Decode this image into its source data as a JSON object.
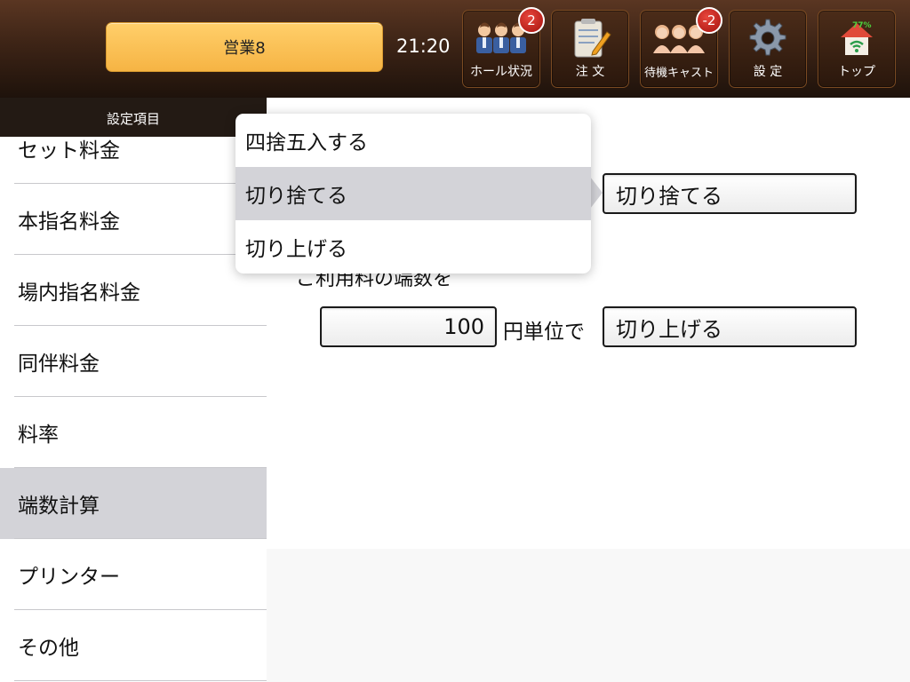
{
  "header": {
    "session_label": "営業8",
    "clock": "21:20",
    "nav": [
      {
        "label": "ホール状況",
        "icon": "staff-group-icon",
        "badge": "2"
      },
      {
        "label": "注 文",
        "icon": "order-notepad-icon",
        "badge": null
      },
      {
        "label": "待機キャスト",
        "icon": "cast-group-icon",
        "badge": "-2"
      },
      {
        "label": "設 定",
        "icon": "gear-icon",
        "badge": null
      },
      {
        "label": "トップ",
        "icon": "home-wifi-icon",
        "badge": null
      }
    ],
    "wifi_percent": "77%"
  },
  "sidebar": {
    "title": "設定項目",
    "items": [
      "セット料金",
      "本指名料金",
      "場内指名料金",
      "同伴料金",
      "料率",
      "端数計算",
      "プリンター",
      "その他"
    ],
    "selected_index": 5
  },
  "rounding": {
    "sentence": "ご利用料の端数を",
    "amount_value": "100",
    "unit_text": "円単位で",
    "first_method_value": "切り捨てる",
    "second_method_value": "切り上げる"
  },
  "dropdown": {
    "options": [
      "四捨五入する",
      "切り捨てる",
      "切り上げる"
    ],
    "selected_index": 1
  },
  "colors": {
    "header_brown": "#3d2416",
    "session_orange": "#f6b444",
    "badge_red": "#c8231c",
    "selected_gray": "#d3d3d8"
  }
}
